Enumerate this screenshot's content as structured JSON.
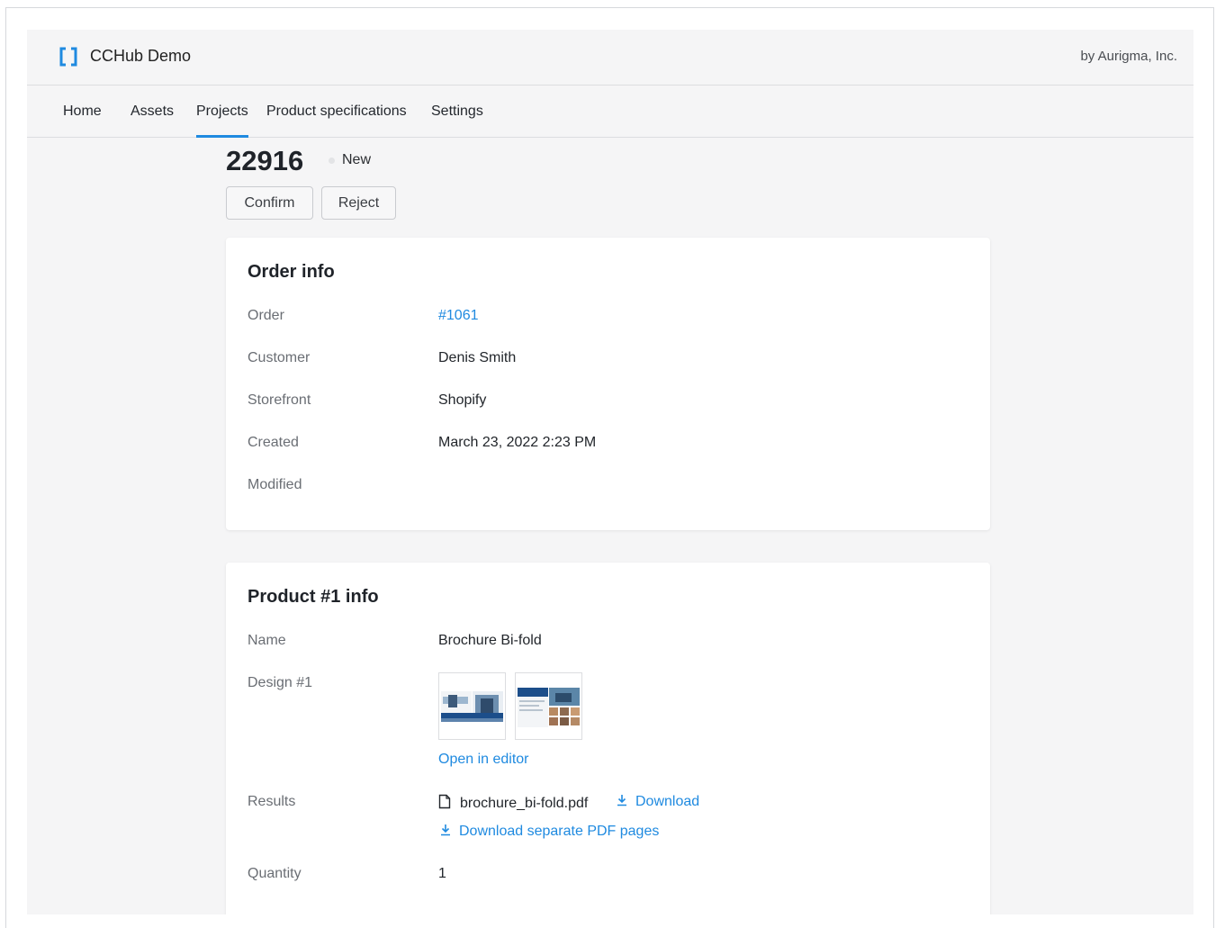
{
  "header": {
    "app_name": "CCHub Demo",
    "vendor": "by Aurigma, Inc.",
    "logo_icon": "bracket-logo-icon",
    "accent_color": "#1f8ae0"
  },
  "nav": {
    "items": [
      {
        "label": "Home",
        "active": false
      },
      {
        "label": "Assets",
        "active": false
      },
      {
        "label": "Projects",
        "active": true
      },
      {
        "label": "Product specifications",
        "active": false
      },
      {
        "label": "Settings",
        "active": false
      }
    ]
  },
  "project": {
    "id": "22916",
    "status": "New",
    "actions": {
      "confirm": "Confirm",
      "reject": "Reject"
    }
  },
  "order_info": {
    "title": "Order info",
    "rows": [
      {
        "label": "Order",
        "value": "#1061"
      },
      {
        "label": "Customer",
        "value": "Denis Smith"
      },
      {
        "label": "Storefront",
        "value": "Shopify"
      },
      {
        "label": "Created",
        "value": "March 23, 2022 2:23 PM"
      },
      {
        "label": "Modified",
        "value": ""
      }
    ]
  },
  "product_info": {
    "title": "Product #1 info",
    "name_label": "Name",
    "name_value": "Brochure Bi-fold",
    "design_label": "Design #1",
    "open_editor": "Open in editor",
    "results_label": "Results",
    "file_name": "brochure_bi-fold.pdf",
    "download": "Download",
    "download_pages": "Download separate PDF pages",
    "quantity_label": "Quantity",
    "quantity_value": "1"
  }
}
